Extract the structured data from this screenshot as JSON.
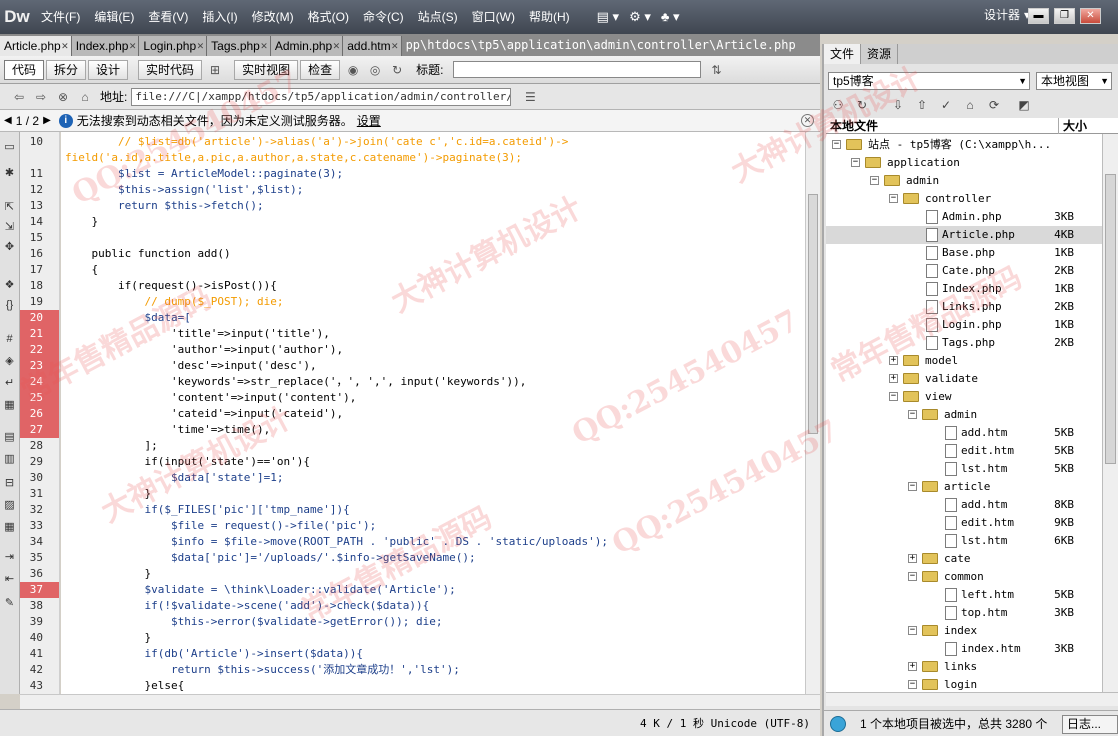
{
  "app": {
    "logo": "Dw",
    "workspace": "设计器"
  },
  "menu": [
    "文件(F)",
    "编辑(E)",
    "查看(V)",
    "插入(I)",
    "修改(M)",
    "格式(O)",
    "命令(C)",
    "站点(S)",
    "窗口(W)",
    "帮助(H)"
  ],
  "tabs": [
    "Article.php",
    "Index.php",
    "Login.php",
    "Tags.php",
    "Admin.php",
    "add.htm"
  ],
  "filepath": "pp\\htdocs\\tp5\\application\\admin\\controller\\Article.php",
  "toolbar": {
    "code": "代码",
    "split": "拆分",
    "design": "设计",
    "live_code": "实时代码",
    "live_view": "实时视图",
    "inspect": "检查",
    "title_label": "标题:"
  },
  "address": {
    "label": "地址:",
    "value": "file:///C|/xampp/htdocs/tp5/application/admin/controller/Articl"
  },
  "info": {
    "page": "1 / 2",
    "message": "无法搜索到动态相关文件，因为未定义测试服务器。",
    "settings": "设置"
  },
  "code": {
    "first_line": 10,
    "error_lines": [
      20,
      21,
      22,
      23,
      24,
      25,
      26,
      27,
      37
    ],
    "lines": [
      [
        "cmt",
        "        // $list=db('article')->alias('a')->join('cate c','c.id=a.cateid')->"
      ],
      [
        "cmt",
        "field('a.id,a.title,a.pic,a.author,a.state,c.catename')->paginate(3);"
      ],
      [
        "n",
        "        $list = ArticleModel::paginate(3);"
      ],
      [
        "n",
        "        $this->assign('list',$list);"
      ],
      [
        "n",
        "        return $this->fetch();"
      ],
      [
        "n",
        "    }"
      ],
      [
        "n",
        ""
      ],
      [
        "n",
        "    public function add()"
      ],
      [
        "n",
        "    {"
      ],
      [
        "n",
        "        if(request()->isPost()){"
      ],
      [
        "cmt",
        "            // dump($_POST); die;"
      ],
      [
        "n",
        "            $data=["
      ],
      [
        "n",
        "                'title'=>input('title'),"
      ],
      [
        "n",
        "                'author'=>input('author'),"
      ],
      [
        "n",
        "                'desc'=>input('desc'),"
      ],
      [
        "n",
        "                'keywords'=>str_replace('，', ',', input('keywords')),"
      ],
      [
        "n",
        "                'content'=>input('content'),"
      ],
      [
        "n",
        "                'cateid'=>input('cateid'),"
      ],
      [
        "n",
        "                'time'=>time(),"
      ],
      [
        "n",
        "            ];"
      ],
      [
        "n",
        "            if(input('state')=='on'){"
      ],
      [
        "n",
        "                $data['state']=1;"
      ],
      [
        "n",
        "            }"
      ],
      [
        "n",
        "            if($_FILES['pic']['tmp_name']){"
      ],
      [
        "n",
        "                $file = request()->file('pic');"
      ],
      [
        "n",
        "                $info = $file->move(ROOT_PATH . 'public' . DS . 'static/uploads');"
      ],
      [
        "n",
        "                $data['pic']='/uploads/'.$info->getSaveName();"
      ],
      [
        "n",
        "            }"
      ],
      [
        "n",
        "            $validate = \\think\\Loader::validate('Article');"
      ],
      [
        "n",
        "            if(!$validate->scene('add')->check($data)){"
      ],
      [
        "n",
        "                $this->error($validate->getError()); die;"
      ],
      [
        "n",
        "            }"
      ],
      [
        "n",
        "            if(db('Article')->insert($data)){"
      ],
      [
        "n",
        "                return $this->success('添加文章成功！','lst');"
      ],
      [
        "n",
        "            }else{"
      ]
    ]
  },
  "line_numbers": [
    "10",
    "",
    "11",
    "12",
    "13",
    "14",
    "15",
    "16",
    "17",
    "18",
    "19",
    "20",
    "21",
    "22",
    "23",
    "24",
    "25",
    "26",
    "27",
    "28",
    "29",
    "30",
    "31",
    "32",
    "33",
    "34",
    "35",
    "36",
    "37",
    "38",
    "39",
    "40",
    "41",
    "42",
    "43"
  ],
  "status": {
    "info": "4 K / 1 秒  Unicode (UTF-8)"
  },
  "panel": {
    "tabs": [
      "文件",
      "资源"
    ],
    "site": "tp5博客",
    "view": "本地视图",
    "col_file": "本地文件",
    "col_size": "大小",
    "tree": [
      {
        "label": "站点 - tp5博客 (C:\\xampp\\h...",
        "d": 0,
        "t": "root",
        "e": "-"
      },
      {
        "label": "application",
        "d": 1,
        "t": "folder",
        "e": "-"
      },
      {
        "label": "admin",
        "d": 2,
        "t": "folder",
        "e": "-"
      },
      {
        "label": "controller",
        "d": 3,
        "t": "folder",
        "e": "-"
      },
      {
        "label": "Admin.php",
        "d": 4,
        "t": "file",
        "s": "3KB"
      },
      {
        "label": "Article.php",
        "d": 4,
        "t": "file",
        "s": "4KB",
        "sel": true
      },
      {
        "label": "Base.php",
        "d": 4,
        "t": "file",
        "s": "1KB"
      },
      {
        "label": "Cate.php",
        "d": 4,
        "t": "file",
        "s": "2KB"
      },
      {
        "label": "Index.php",
        "d": 4,
        "t": "file",
        "s": "1KB"
      },
      {
        "label": "Links.php",
        "d": 4,
        "t": "file",
        "s": "2KB"
      },
      {
        "label": "Login.php",
        "d": 4,
        "t": "file",
        "s": "1KB"
      },
      {
        "label": "Tags.php",
        "d": 4,
        "t": "file",
        "s": "2KB"
      },
      {
        "label": "model",
        "d": 3,
        "t": "folder",
        "e": "+"
      },
      {
        "label": "validate",
        "d": 3,
        "t": "folder",
        "e": "+"
      },
      {
        "label": "view",
        "d": 3,
        "t": "folder",
        "e": "-"
      },
      {
        "label": "admin",
        "d": 4,
        "t": "folder",
        "e": "-"
      },
      {
        "label": "add.htm",
        "d": 5,
        "t": "file",
        "s": "5KB"
      },
      {
        "label": "edit.htm",
        "d": 5,
        "t": "file",
        "s": "5KB"
      },
      {
        "label": "lst.htm",
        "d": 5,
        "t": "file",
        "s": "5KB"
      },
      {
        "label": "article",
        "d": 4,
        "t": "folder",
        "e": "-"
      },
      {
        "label": "add.htm",
        "d": 5,
        "t": "file",
        "s": "8KB"
      },
      {
        "label": "edit.htm",
        "d": 5,
        "t": "file",
        "s": "9KB"
      },
      {
        "label": "lst.htm",
        "d": 5,
        "t": "file",
        "s": "6KB"
      },
      {
        "label": "cate",
        "d": 4,
        "t": "folder",
        "e": "+"
      },
      {
        "label": "common",
        "d": 4,
        "t": "folder",
        "e": "-"
      },
      {
        "label": "left.htm",
        "d": 5,
        "t": "file",
        "s": "5KB"
      },
      {
        "label": "top.htm",
        "d": 5,
        "t": "file",
        "s": "3KB"
      },
      {
        "label": "index",
        "d": 4,
        "t": "folder",
        "e": "-"
      },
      {
        "label": "index.htm",
        "d": 5,
        "t": "file",
        "s": "3KB"
      },
      {
        "label": "links",
        "d": 4,
        "t": "folder",
        "e": "+"
      },
      {
        "label": "login",
        "d": 4,
        "t": "folder",
        "e": "-"
      }
    ],
    "status": "1 个本地项目被选中，总共 3280 个",
    "log": "日志..."
  },
  "watermarks": [
    "QQ:254540457",
    "大神计算机设计",
    "常年售精品源码",
    "QQ:254540457",
    "大神计算机设计",
    "常年售精品源码",
    "QQ:254540457",
    "大神计算机设计",
    "常年售精品源码"
  ]
}
